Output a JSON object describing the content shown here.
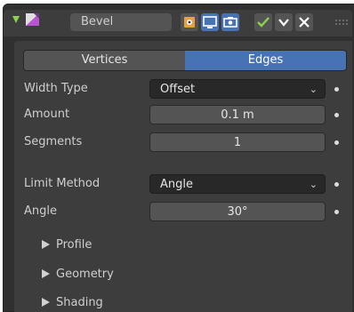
{
  "header": {
    "modifier_name": "Bevel",
    "icons": [
      "expand-arrow-icon",
      "bevel-modifier-icon",
      "edit-mode-icon",
      "viewport-display-icon",
      "render-camera-icon",
      "apply-check-icon",
      "dropdown-chevron-icon",
      "close-icon",
      "drag-grip-icon"
    ]
  },
  "tabs": [
    {
      "label": "Vertices",
      "active": false
    },
    {
      "label": "Edges",
      "active": true
    }
  ],
  "properties": {
    "width_type": {
      "label": "Width Type",
      "value": "Offset"
    },
    "amount": {
      "label": "Amount",
      "value": "0.1 m"
    },
    "segments": {
      "label": "Segments",
      "value": "1"
    },
    "limit_method": {
      "label": "Limit Method",
      "value": "Angle"
    },
    "angle": {
      "label": "Angle",
      "value": "30°"
    }
  },
  "subpanels": {
    "profile": "Profile",
    "geometry": "Geometry",
    "shading": "Shading"
  },
  "colors": {
    "accent": "#4772b3",
    "panel_bg": "#3d3d3d",
    "check_green": "#8fd14f"
  }
}
